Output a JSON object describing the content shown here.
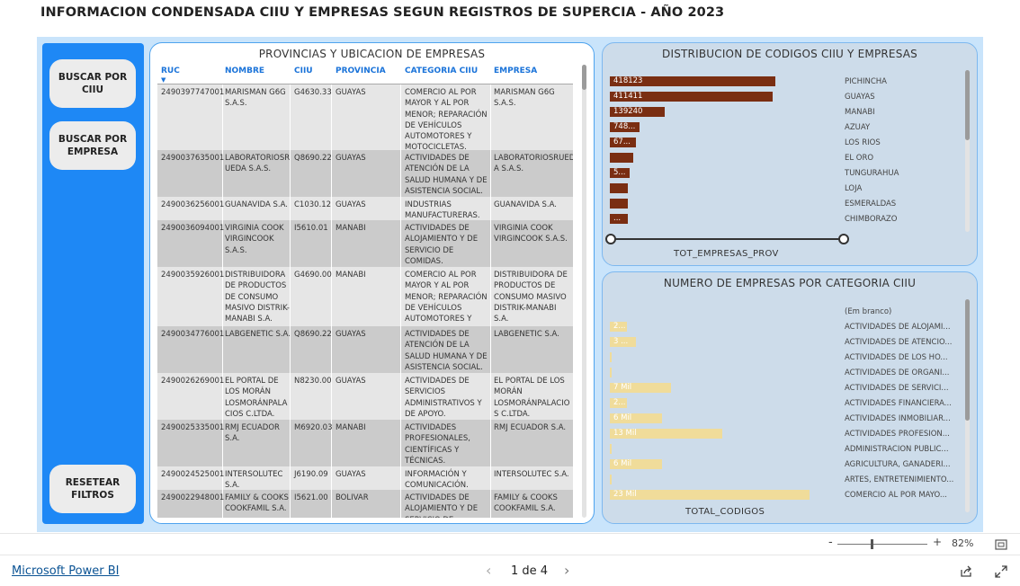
{
  "title": "INFORMACION CONDENSADA CIIU Y EMPRESAS SEGUN REGISTROS DE SUPERCIA - AÑO 2023",
  "sidebar": {
    "buttons": [
      "BUSCAR POR CIIU",
      "BUSCAR POR EMPRESA",
      "RESETEAR FILTROS"
    ]
  },
  "table_panel": {
    "title": "PROVINCIAS Y UBICACION DE EMPRESAS",
    "columns": [
      "RUC",
      "NOMBRE",
      "CIIU",
      "PROVINCIA",
      "CATEGORIA CIIU",
      "EMPRESA"
    ],
    "rows": [
      [
        "2490397747001",
        "MARISMAN G6G S.A.S.",
        "G4630.33",
        "GUAYAS",
        "COMERCIO AL POR MAYOR Y AL POR MENOR; REPARACIÓN DE VEHÍCULOS AUTOMOTORES Y MOTOCICLETAS.",
        "MARISMAN G6G S.A.S."
      ],
      [
        "2490037635001",
        "LABORATORIOSR UEDA S.A.S.",
        "Q8690.22",
        "GUAYAS",
        "ACTIVIDADES DE ATENCIÓN DE LA SALUD HUMANA Y DE ASISTENCIA SOCIAL.",
        "LABORATORIOSRUED A S.A.S."
      ],
      [
        "2490036256001",
        "GUANAVIDA S.A.",
        "C1030.12",
        "GUAYAS",
        "INDUSTRIAS MANUFACTURERAS.",
        "GUANAVIDA S.A."
      ],
      [
        "2490036094001",
        "VIRGINIA COOK VIRGINCOOK S.A.S.",
        "I5610.01",
        "MANABI",
        "ACTIVIDADES DE ALOJAMIENTO Y DE SERVICIO DE COMIDAS.",
        "VIRGINIA COOK VIRGINCOOK S.A.S."
      ],
      [
        "2490035926001",
        "DISTRIBUIDORA DE PRODUCTOS DE CONSUMO MASIVO DISTRIK-MANABI S.A.",
        "G4690.00",
        "MANABI",
        "COMERCIO AL POR MAYOR Y AL POR MENOR; REPARACIÓN DE VEHÍCULOS AUTOMOTORES Y",
        "DISTRIBUIDORA DE PRODUCTOS DE CONSUMO MASIVO DISTRIK-MANABI S.A."
      ],
      [
        "2490034776001",
        "LABGENETIC S.A.",
        "Q8690.22",
        "GUAYAS",
        "ACTIVIDADES DE ATENCIÓN DE LA SALUD HUMANA Y DE ASISTENCIA SOCIAL.",
        "LABGENETIC S.A."
      ],
      [
        "2490026269001",
        "EL PORTAL DE LOS MORÁN LOSMORÁNPALA CIOS C.LTDA.",
        "N8230.00",
        "GUAYAS",
        "ACTIVIDADES DE SERVICIOS ADMINISTRATIVOS Y DE APOYO.",
        "EL PORTAL DE LOS MORÁN LOSMORÁNPALACIO S C.LTDA."
      ],
      [
        "2490025335001",
        "RMJ ECUADOR S.A.",
        "M6920.03",
        "MANABI",
        "ACTIVIDADES PROFESIONALES, CIENTÍFICAS Y TÉCNICAS.",
        "RMJ ECUADOR S.A."
      ],
      [
        "2490024525001",
        "INTERSOLUTEC S.A.",
        "J6190.09",
        "GUAYAS",
        "INFORMACIÓN Y COMUNICACIÓN.",
        "INTERSOLUTEC S.A."
      ],
      [
        "2490022948001",
        "FAMILY & COOKS COOKFAMIL S.A.",
        "I5621.00",
        "BOLIVAR",
        "ACTIVIDADES DE ALOJAMIENTO Y DE SERVICIO DE",
        "FAMILY & COOKS COOKFAMIL S.A."
      ]
    ]
  },
  "chart_provincias": {
    "title": "DISTRIBUCION DE CODIGOS CIIU Y EMPRESAS",
    "axis_title": "TOT_EMPRESAS_PROV",
    "bar_color": "#7a2e12",
    "categories": [
      "PICHINCHA",
      "GUAYAS",
      "MANABI",
      "AZUAY",
      "LOS RIOS",
      "EL ORO",
      "TUNGURAHUA",
      "LOJA",
      "ESMERALDAS",
      "CHIMBORAZO"
    ],
    "data_labels": [
      "418123",
      "411411",
      "139240",
      "748...",
      "67...",
      "",
      "5...",
      "",
      "",
      "..."
    ]
  },
  "chart_categorias": {
    "title": "NUMERO DE EMPRESAS POR CATEGORIA CIIU",
    "axis_title": "TOTAL_CODIGOS",
    "bar_color": "#f0dc9a",
    "categories": [
      "(Em branco)",
      "ACTIVIDADES DE ALOJAMI...",
      "ACTIVIDADES DE ATENCIÓ...",
      "ACTIVIDADES DE LOS HO...",
      "ACTIVIDADES DE ORGANI...",
      "ACTIVIDADES DE SERVICI...",
      "ACTIVIDADES FINANCIERA...",
      "ACTIVIDADES INMOBILIAR...",
      "ACTIVIDADES PROFESION...",
      "ADMINISTRACIÓN PÚBLIC...",
      "AGRICULTURA, GANADERÍ...",
      "ARTES, ENTRETENIMIENTO...",
      "COMERCIO AL POR MAYO..."
    ],
    "data_labels": [
      "",
      "2...",
      "3 ...",
      "",
      "",
      "7 Mil",
      "2...",
      "6 Mil",
      "13 Mil",
      "",
      "6 Mil",
      "",
      "23 Mil"
    ]
  },
  "chart_data": [
    {
      "type": "bar",
      "title": "DISTRIBUCION DE CODIGOS CIIU Y EMPRESAS",
      "xlabel": "TOT_EMPRESAS_PROV",
      "categories": [
        "PICHINCHA",
        "GUAYAS",
        "MANABI",
        "AZUAY",
        "LOS RIOS",
        "EL ORO",
        "TUNGURAHUA",
        "LOJA",
        "ESMERALDAS",
        "CHIMBORAZO"
      ],
      "values": [
        418123,
        411411,
        139240,
        74800,
        67000,
        60000,
        50000,
        45000,
        44000,
        42000
      ]
    },
    {
      "type": "bar",
      "title": "NUMERO DE EMPRESAS POR CATEGORIA CIIU",
      "xlabel": "TOTAL_CODIGOS",
      "categories": [
        "(Em branco)",
        "ACTIVIDADES DE ALOJAMI...",
        "ACTIVIDADES DE ATENCIÓ...",
        "ACTIVIDADES DE LOS HO...",
        "ACTIVIDADES DE ORGANI...",
        "ACTIVIDADES DE SERVICI...",
        "ACTIVIDADES FINANCIERA...",
        "ACTIVIDADES INMOBILIAR...",
        "ACTIVIDADES PROFESION...",
        "ADMINISTRACIÓN PÚBLIC...",
        "AGRICULTURA, GANADERÍ...",
        "ARTES, ENTRETENIMIENTO...",
        "COMERCIO AL POR MAYO..."
      ],
      "values": [
        0,
        2000,
        3000,
        100,
        100,
        7000,
        2000,
        6000,
        13000,
        100,
        6000,
        100,
        23000
      ]
    }
  ],
  "footer": {
    "brand": "Microsoft Power BI",
    "page_indicator": "1 de 4",
    "zoom_level": "82%"
  }
}
